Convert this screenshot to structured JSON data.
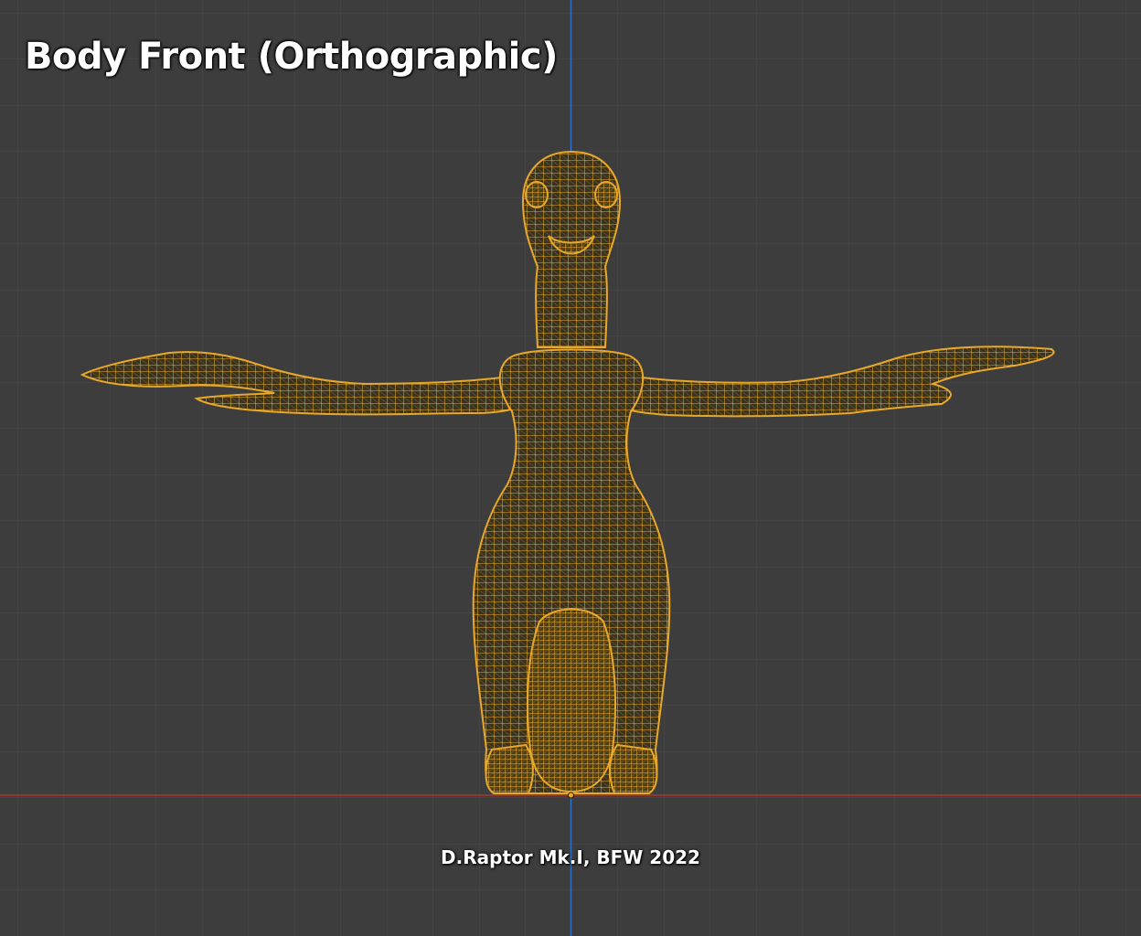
{
  "viewport": {
    "view_title": "Body Front (Orthographic)",
    "credit": "D.Raptor Mk.I, BFW 2022",
    "mode": "wireframe"
  },
  "colors": {
    "background": "#3d3d3d",
    "grid_minor": "#4a4a4a",
    "grid_major": "#555555",
    "x_axis": "#c0392b",
    "z_axis": "#2a6fc9",
    "wireframe": "#e8a82a"
  }
}
